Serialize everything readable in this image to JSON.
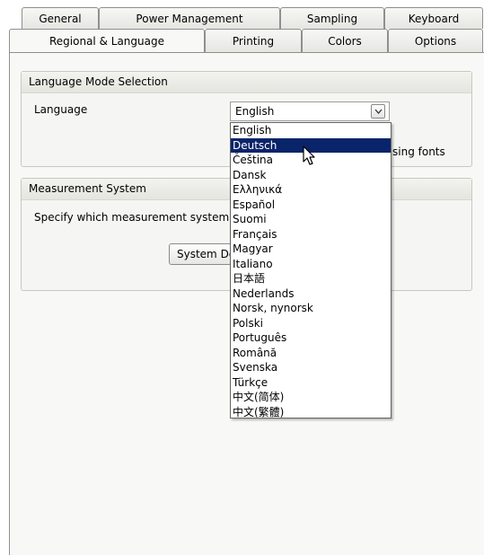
{
  "tabs": {
    "row1": [
      "General",
      "Power Management",
      "Sampling",
      "Keyboard"
    ],
    "row2": [
      "Regional & Language",
      "Printing",
      "Colors",
      "Options"
    ],
    "active": "Regional & Language"
  },
  "language_group": {
    "title": "Language Mode Selection",
    "language_label": "Language",
    "selected_value": "English",
    "partial_label": "sing fonts",
    "options": [
      "English",
      "Deutsch",
      "Čeština",
      "Dansk",
      "Ελληνικά",
      "Español",
      "Suomi",
      "Français",
      "Magyar",
      "Italiano",
      "日本語",
      "Nederlands",
      "Norsk, nynorsk",
      "Polski",
      "Português",
      "Română",
      "Svenska",
      "Türkçe",
      "中文(简体)",
      "中文(繁體)"
    ],
    "highlighted_option": "Deutsch"
  },
  "measurement_group": {
    "title": "Measurement System",
    "description": "Specify which measurement system",
    "button_label": "System De"
  },
  "colors": {
    "highlight": "#0a246a",
    "panel": "#f8f8f6"
  }
}
